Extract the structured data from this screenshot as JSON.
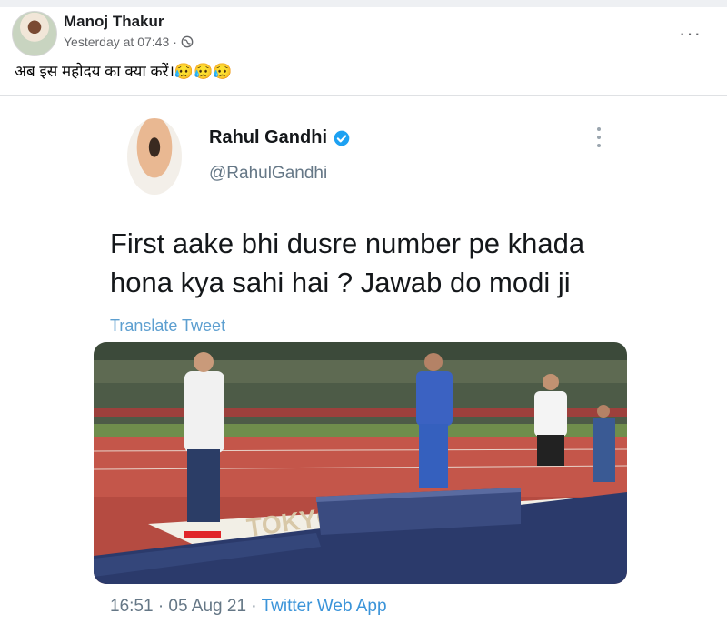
{
  "post": {
    "author": "Manoj Thakur",
    "time": "Yesterday at 07:43",
    "dot": "·",
    "more": "···",
    "text": "अब इस महोदय का क्या करें।😥😥😥"
  },
  "tweet": {
    "name": "Rahul Gandhi",
    "handle": "@RahulGandhi",
    "text": "First aake bhi dusre number pe khada hona kya sahi hai ? Jawab do modi ji",
    "translate": "Translate Tweet",
    "timestamp": "16:51 · 05 Aug 21 · ",
    "app": "Twitter Web App",
    "image_banner": "TOKYO 2020"
  },
  "colors": {
    "link_blue": "#3b94d9",
    "verified_blue": "#1da1f2",
    "podium_blue": "#2b3a6b",
    "track_red": "#c9493b"
  }
}
